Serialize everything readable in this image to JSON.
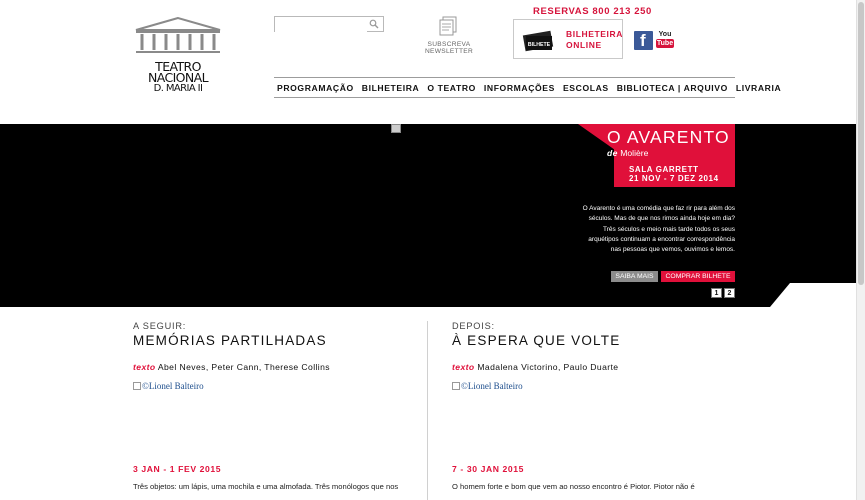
{
  "header": {
    "logo": {
      "line1": "TEATRO",
      "line2": "NACIONAL",
      "line3": "D. MARIA II"
    },
    "search": {
      "value": "",
      "placeholder": ""
    },
    "newsletter": {
      "line1": "SUBSCREVA",
      "line2": "NEWSLETTER"
    },
    "reservas": "RESERVAS 800 213 250",
    "bilheteira": {
      "line1": "BILHETEIRA",
      "line2": "ONLINE",
      "ticket_text": "BILHETE"
    },
    "social": {
      "facebook": "f",
      "youtube_you": "You",
      "youtube_tube": "Tube"
    }
  },
  "nav": {
    "items": [
      {
        "label": "PROGRAMAÇÃO"
      },
      {
        "label": "BILHETEIRA"
      },
      {
        "label": "O TEATRO"
      },
      {
        "label": "INFORMAÇÕES"
      },
      {
        "label": "ESCOLAS"
      },
      {
        "label": "BIBLIOTECA | ARQUIVO"
      },
      {
        "label": "LIVRARIA"
      }
    ]
  },
  "hero": {
    "title": "O AVARENTO",
    "author_prefix": "de",
    "author": "Molière",
    "venue": "SALA GARRETT",
    "dates": "21 NOV - 7 DEZ 2014",
    "description": "O Avarento é uma comédia que faz rir para além dos séculos. Mas de que nos rimos ainda hoje em dia? Três séculos e meio mais tarde todos os seus arquétipos continuam a encontrar correspondência nas pessoas que vemos, ouvimos e lemos.",
    "btn_more": "SAIBA MAIS",
    "btn_buy": "COMPRAR BILHETE",
    "pages": [
      "1",
      "2"
    ]
  },
  "columns": [
    {
      "label": "A SEGUIR:",
      "title": "MEMÓRIAS PARTILHADAS",
      "credits_prefix": "texto",
      "credits": "Abel Neves, Peter Cann, Therese Collins",
      "photo_alt": "©Lionel Balteiro",
      "dates": "3 JAN - 1 FEV 2015",
      "excerpt": "Três objetos: um lápis, uma mochila e uma almofada. Três monólogos que nos"
    },
    {
      "label": "DEPOIS:",
      "title": "À ESPERA QUE VOLTE",
      "credits_prefix": "texto",
      "credits": "Madalena Victorino, Paulo Duarte",
      "photo_alt": "©Lionel Balteiro",
      "dates": "7 - 30 JAN 2015",
      "excerpt": "O homem forte e bom que vem ao nosso encontro é Piotor. Piotor não é"
    }
  ],
  "colors": {
    "accent": "#e0103a",
    "hero_bg": "#000000",
    "facebook": "#3b5998"
  }
}
